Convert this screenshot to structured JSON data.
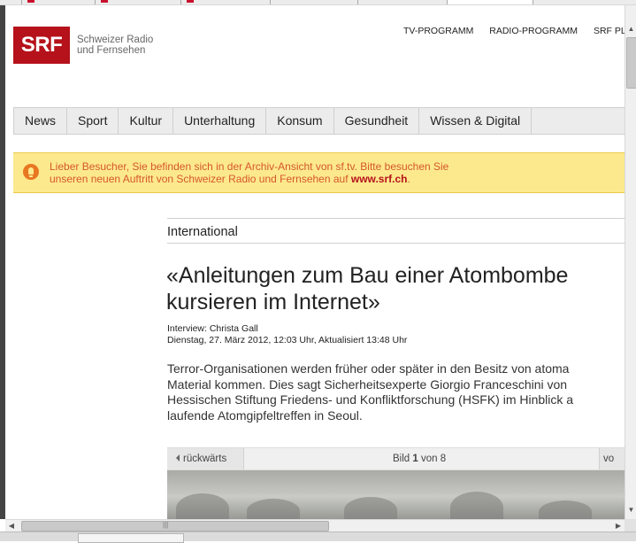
{
  "header": {
    "logo": "SRF",
    "brand_line1": "Schweizer Radio",
    "brand_line2": "und Fernsehen",
    "topnav": [
      "TV-PROGRAMM",
      "RADIO-PROGRAMM",
      "SRF PLAY"
    ]
  },
  "mainnav": [
    "News",
    "Sport",
    "Kultur",
    "Unterhaltung",
    "Konsum",
    "Gesundheit",
    "Wissen & Digital"
  ],
  "notice": {
    "text_line1": "Lieber Besucher, Sie befinden sich in der Archiv-Ansicht von sf.tv. Bitte besuchen Sie",
    "text_line2": "unseren neuen Auftritt von Schweizer Radio und Fernsehen auf ",
    "link": "www.srf.ch",
    "end": "."
  },
  "article": {
    "section": "International",
    "headline_line1": "«Anleitungen zum Bau einer Atombombe",
    "headline_line2": "kursieren im Internet»",
    "author": "Interview: Christa Gall",
    "date": "Dienstag, 27. März 2012, 12:03 Uhr, Aktualisiert 13:48 Uhr",
    "lead": [
      "Terror-Organisationen werden früher oder später in den Besitz von atoma",
      "Material kommen. Dies sagt Sicherheitsexperte Giorgio Franceschini von",
      "Hessischen Stiftung Friedens- und Konfliktforschung (HSFK) im Hinblick a",
      "laufende Atomgipfeltreffen in Seoul."
    ]
  },
  "gallery": {
    "back_label": "rückwärts",
    "bild_word": "Bild",
    "current": "1",
    "of_word": "von",
    "total": "8",
    "forward_label": "vo"
  },
  "scroll": {
    "up": "▲",
    "down": "▼",
    "left": "◀",
    "right": "▶",
    "grip": "|||"
  }
}
